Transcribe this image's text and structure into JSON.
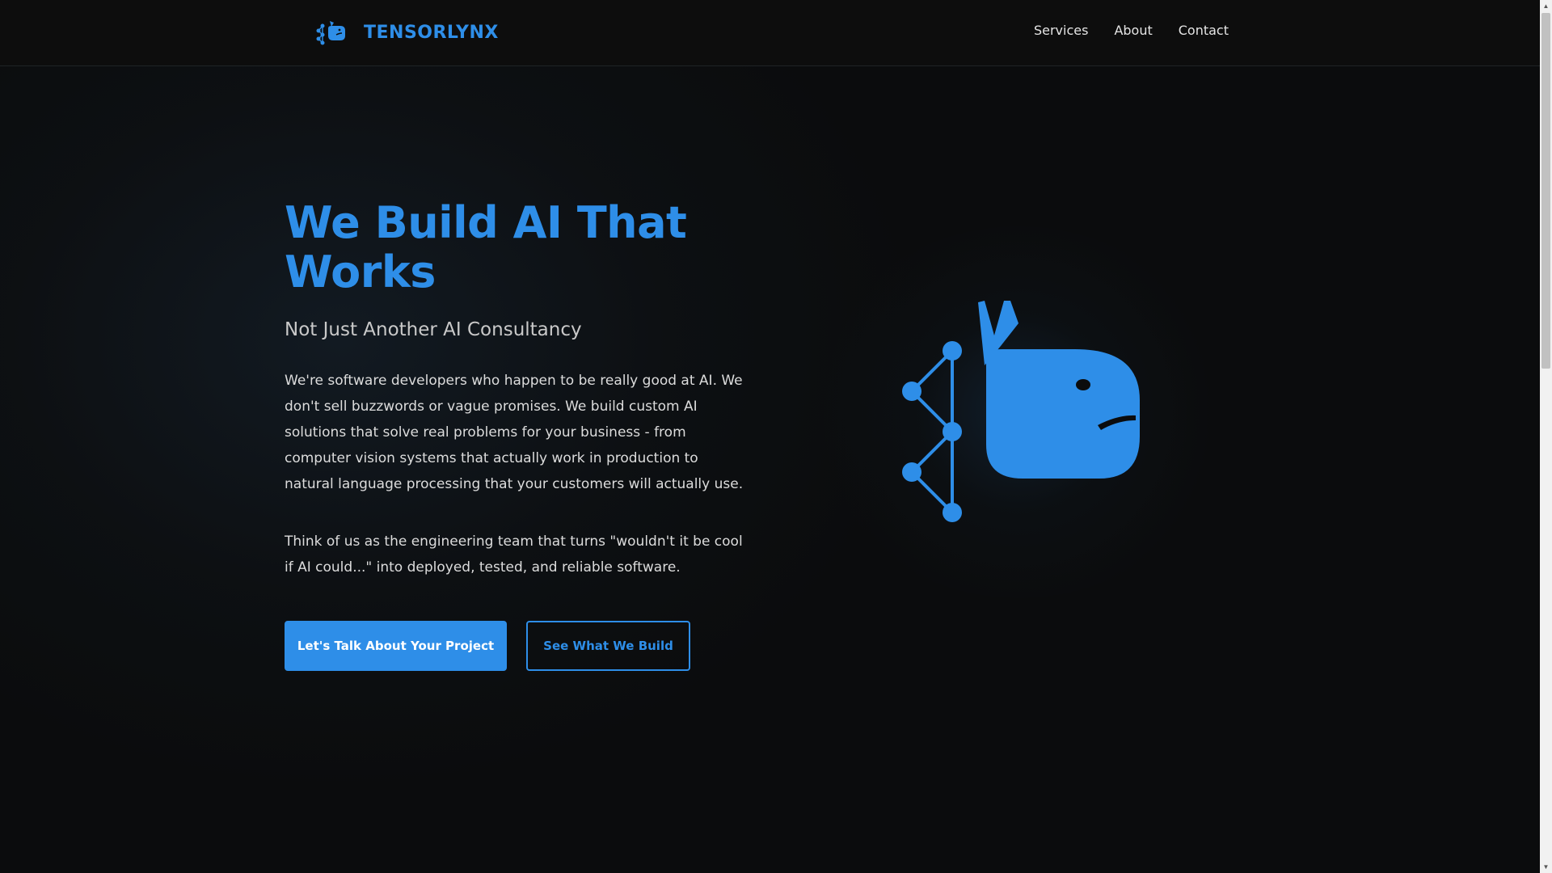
{
  "header": {
    "brand_name": "TENSORLYNX",
    "nav": [
      "Services",
      "About",
      "Contact"
    ]
  },
  "hero": {
    "title": "We Build AI That Works",
    "subtitle": "Not Just Another AI Consultancy",
    "paragraph1": "We're software developers who happen to be really good at AI. We don't sell buzzwords or vague promises. We build custom AI solutions that solve real problems for your business - from computer vision systems that actually work in production to natural language processing that your customers will actually use.",
    "paragraph2": "Think of us as the engineering team that turns \"wouldn't it be cool if AI could...\" into deployed, tested, and reliable software.",
    "primary_button": "Let's Talk About Your Project",
    "secondary_button": "See What We Build"
  },
  "icons": {
    "logo": "lynx-network-logo-icon",
    "hero_art": "lynx-network-illustration-icon"
  },
  "colors": {
    "accent": "#2e8ee8",
    "background": "#0b0c0d",
    "header_bg": "#0d0d0d",
    "text": "#dcdcdc"
  }
}
